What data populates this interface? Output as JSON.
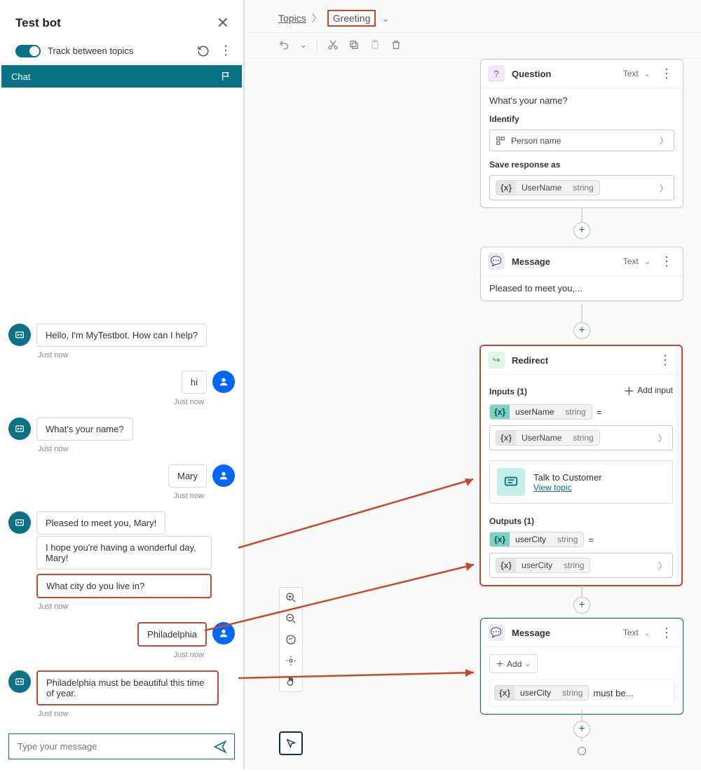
{
  "testPanel": {
    "title": "Test bot",
    "trackLabel": "Track between topics",
    "chatTabLabel": "Chat",
    "messages": {
      "bot1": "Hello, I'm MyTestbot. How can I help?",
      "ts1": "Just now",
      "user1": "hi",
      "ts2": "Just now",
      "bot2": "What's your name?",
      "ts3": "Just now",
      "user2": "Mary",
      "ts4": "Just now",
      "bot3a": "Pleased to meet you, Mary!",
      "bot3b": "I hope you're having a wonderful day, Mary!",
      "bot3c": "What city do you live in?",
      "ts5": "Just now",
      "user3": "Philadelphia",
      "ts6": "Just now",
      "bot4": "Philadelphia must be beautiful this time of year.",
      "ts7": "Just now"
    },
    "inputPlaceholder": "Type your message"
  },
  "breadcrumb": {
    "root": "Topics",
    "current": "Greeting"
  },
  "questionNode": {
    "title": "Question",
    "typeLabel": "Text",
    "prompt": "What's your name?",
    "identifyLabel": "Identify",
    "identifyValue": "Person name",
    "saveLabel": "Save response as",
    "varName": "UserName",
    "varType": "string"
  },
  "messageNode1": {
    "title": "Message",
    "typeLabel": "Text",
    "body": "Pleased to meet you,..."
  },
  "redirectNode": {
    "title": "Redirect",
    "inputsLabel": "Inputs (1)",
    "addInputLabel": "Add input",
    "inVarName": "userName",
    "inVarType": "string",
    "inValName": "UserName",
    "inValType": "string",
    "topicTitle": "Talk to Customer",
    "topicLink": "View topic",
    "outputsLabel": "Outputs (1)",
    "outVarName": "userCity",
    "outVarType": "string",
    "outValName": "userCity",
    "outValType": "string"
  },
  "messageNode2": {
    "title": "Message",
    "typeLabel": "Text",
    "addLabel": "Add",
    "varName": "userCity",
    "varType": "string",
    "suffixText": "must be..."
  }
}
